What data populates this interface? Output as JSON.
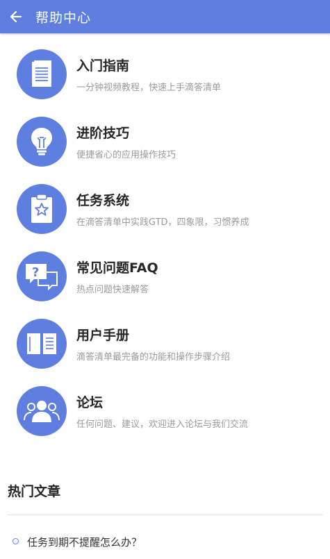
{
  "header": {
    "title": "帮助中心",
    "back_icon": "arrow-left-icon"
  },
  "colors": {
    "accent": "#5f7fe0",
    "title_text": "#262626",
    "desc_text": "#9a9a9a"
  },
  "menu": [
    {
      "title": "入门指南",
      "desc": "一分钟视频教程，快速上手滴答清单",
      "icon": "document-icon"
    },
    {
      "title": "进阶技巧",
      "desc": "便捷省心的应用操作技巧",
      "icon": "lightbulb-icon"
    },
    {
      "title": "任务系统",
      "desc": "在滴答清单中实践GTD，四象限，习惯养成",
      "icon": "clipboard-star-icon"
    },
    {
      "title": "常见问题FAQ",
      "desc": "热点问题快速解答",
      "icon": "question-chat-icon"
    },
    {
      "title": "用户手册",
      "desc": "滴答清单最完备的功能和操作步骤介绍",
      "icon": "open-book-icon"
    },
    {
      "title": "论坛",
      "desc": "任何问题、建议，欢迎进入论坛与我们交流",
      "icon": "people-group-icon"
    }
  ],
  "hot_articles": {
    "title": "热门文章",
    "items": [
      "任务到期不提醒怎么办？"
    ]
  }
}
